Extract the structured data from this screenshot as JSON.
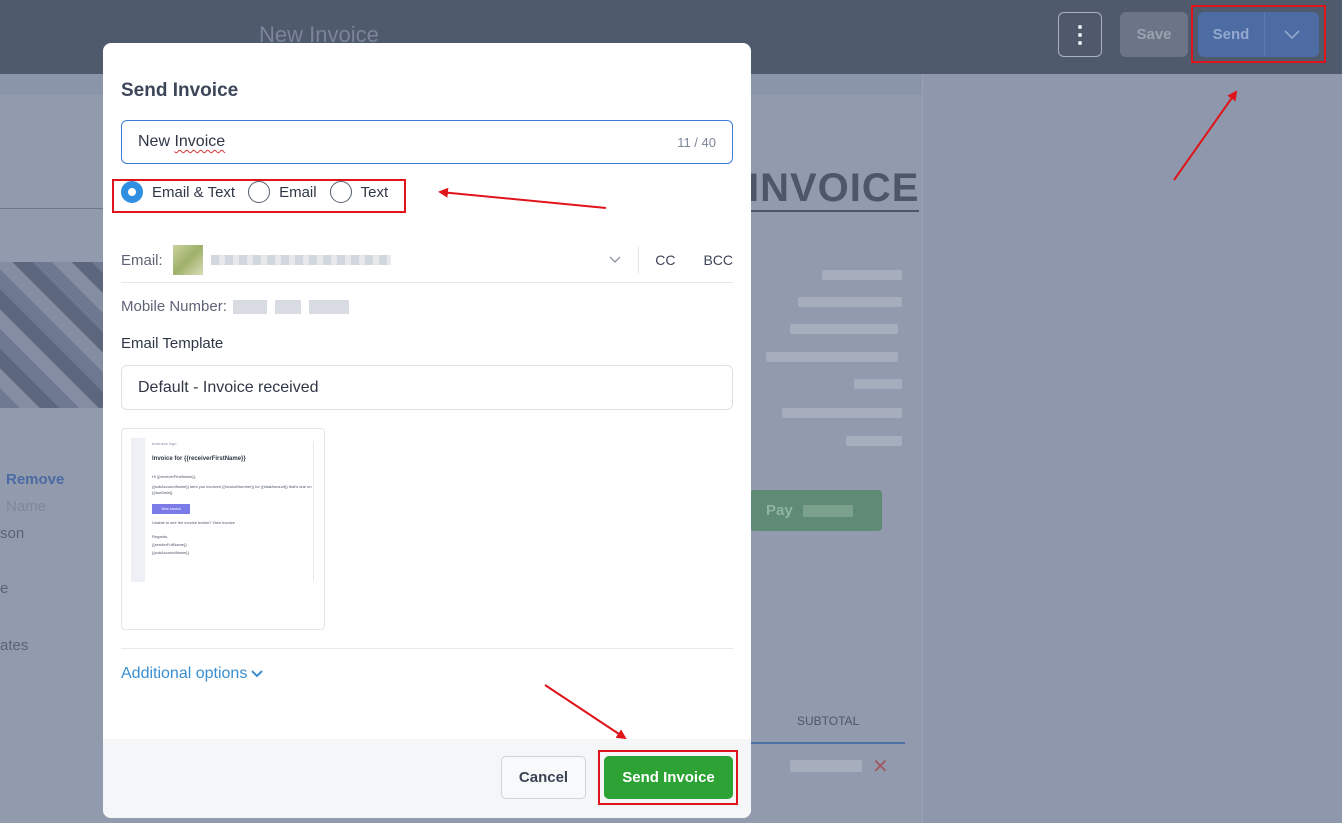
{
  "app": {
    "title": "New Invoice",
    "save_label": "Save",
    "send_label": "Send",
    "invoice_heading": "INVOICE",
    "pay_label": "Pay",
    "remove_label": "Remove",
    "name_fragment": "Name",
    "person_fragment": "son",
    "select_fragment_1": "e",
    "select_fragment_2": "ates",
    "subtotal_header": "SUBTOTAL"
  },
  "modal": {
    "title": "Send Invoice",
    "name_value": "New Invoice",
    "name_value_prefix": "New ",
    "name_value_misspelled": "Invoice",
    "char_count": "11 / 40",
    "send_options": [
      {
        "label": "Email & Text",
        "selected": true
      },
      {
        "label": "Email",
        "selected": false
      },
      {
        "label": "Text",
        "selected": false
      }
    ],
    "email_label": "Email:",
    "cc_label": "CC",
    "bcc_label": "BCC",
    "mobile_label": "Mobile Number:",
    "template_label": "Email Template",
    "template_value": "Default - Invoice received",
    "preview": {
      "logo_alt": "business logo",
      "heading": "Invoice for {{receiverFirstName}}",
      "greeting": "Hi {{receiverFirstName}},",
      "body": "{{subAccountName}} sent you invoice# {{invoiceNumber}} for {{totalAmount}} that's due on {{dueDate}}",
      "button": "View Invoice",
      "fallback": "Unable to see the invoice button? View Invoice",
      "regards": "Regards,",
      "sender": "{{senderFullName}}",
      "account": "{{subAccountName}}"
    },
    "additional_options": "Additional options",
    "cancel_label": "Cancel",
    "send_invoice_label": "Send Invoice"
  },
  "colors": {
    "primary": "#2f8fe0",
    "success": "#2ea335",
    "annotation": "#e0141b"
  }
}
